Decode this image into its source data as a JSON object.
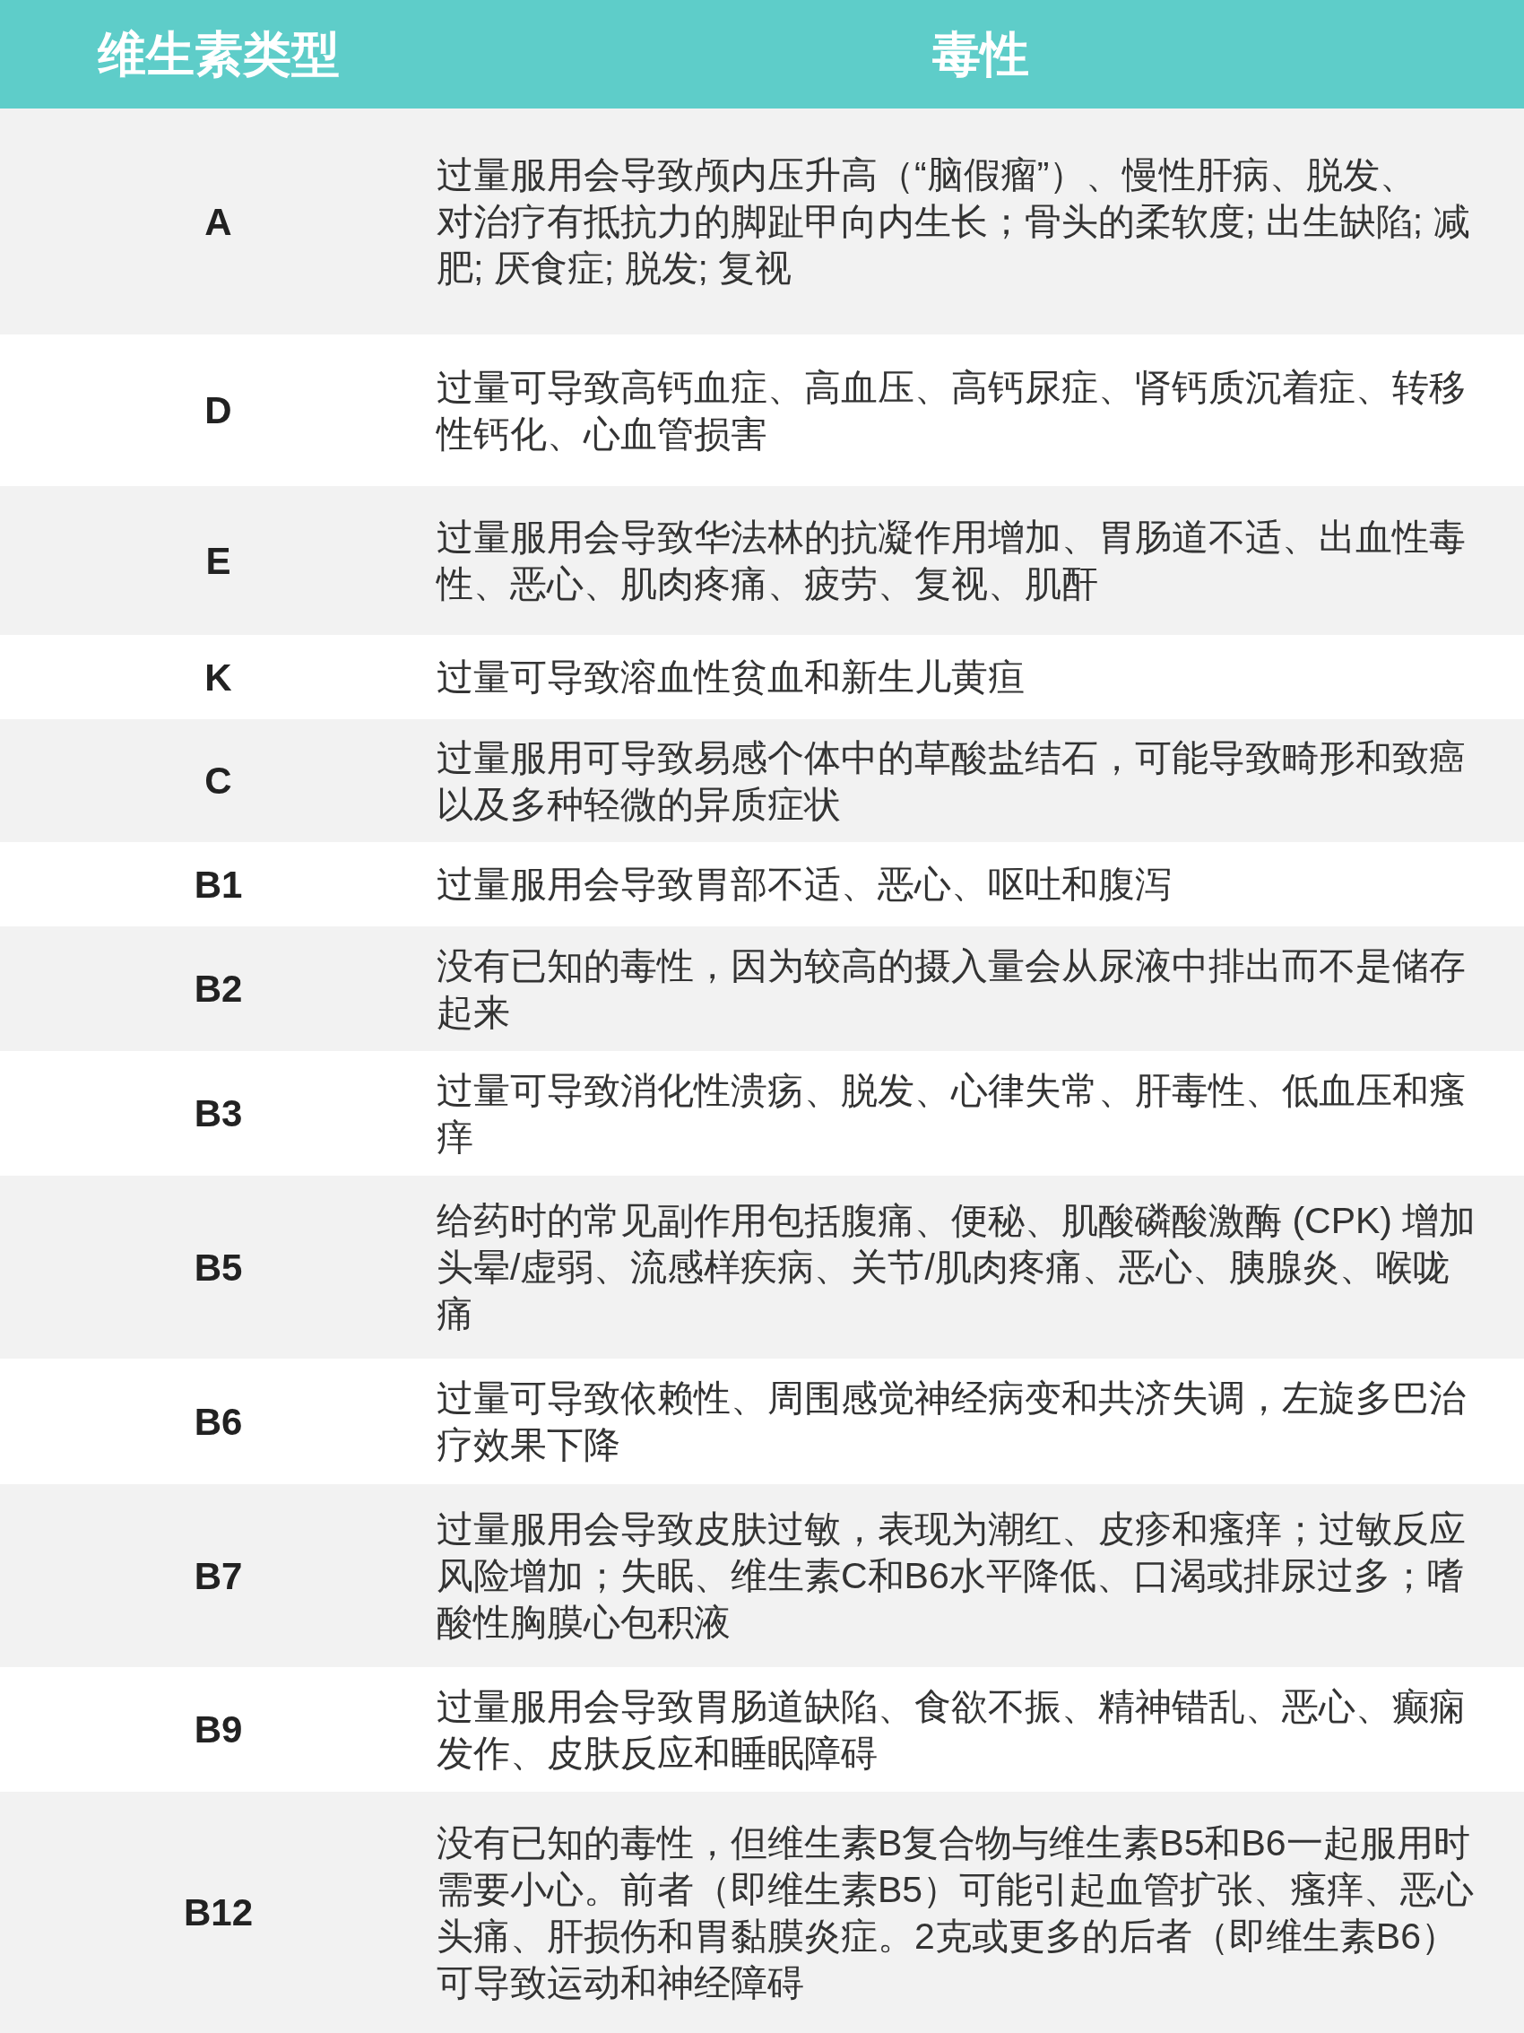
{
  "table": {
    "columns": [
      "维生素类型",
      "毒性"
    ],
    "rows": [
      {
        "vitamin": "A",
        "lines": [
          "过量服用会导致颅内压升高（“脑假瘤”）、慢性肝病、脱发、",
          "对治疗有抵抗力的脚趾甲向内生长；骨头的柔软度; 出生缺陷; 减",
          "肥; 厌食症; 脱发; 复视"
        ]
      },
      {
        "vitamin": "D",
        "lines": [
          "过量可导致高钙血症、高血压、高钙尿症、肾钙质沉着症、转移",
          "性钙化、心血管损害"
        ]
      },
      {
        "vitamin": "E",
        "lines": [
          "过量服用会导致华法林的抗凝作用增加、胃肠道不适、出血性毒",
          "性、恶心、肌肉疼痛、疲劳、复视、肌酐"
        ]
      },
      {
        "vitamin": "K",
        "lines": [
          "过量可导致溶血性贫血和新生儿黄疸"
        ]
      },
      {
        "vitamin": "C",
        "lines": [
          "过量服用可导致易感个体中的草酸盐结石，可能导致畸形和致癌",
          "以及多种轻微的异质症状"
        ]
      },
      {
        "vitamin": "B1",
        "lines": [
          "过量服用会导致胃部不适、恶心、呕吐和腹泻"
        ]
      },
      {
        "vitamin": "B2",
        "lines": [
          "没有已知的毒性，因为较高的摄入量会从尿液中排出而不是储存",
          "起来"
        ]
      },
      {
        "vitamin": "B3",
        "lines": [
          "过量可导致消化性溃疡、脱发、心律失常、肝毒性、低血压和瘙",
          "痒"
        ]
      },
      {
        "vitamin": "B5",
        "lines": [
          "给药时的常见副作用包括腹痛、便秘、肌酸磷酸激酶 (CPK) 增加",
          "头晕/虚弱、流感样疾病、关节/肌肉疼痛、恶心、胰腺炎、喉咙",
          "痛"
        ]
      },
      {
        "vitamin": "B6",
        "lines": [
          "过量可导致依赖性、周围感觉神经病变和共济失调，左旋多巴治",
          "疗效果下降"
        ]
      },
      {
        "vitamin": "B7",
        "lines": [
          "过量服用会导致皮肤过敏，表现为潮红、皮疹和瘙痒；过敏反应",
          "风险增加；失眠、维生素C和B6水平降低、口渴或排尿过多；嗜",
          "酸性胸膜心包积液"
        ]
      },
      {
        "vitamin": "B9",
        "lines": [
          "过量服用会导致胃肠道缺陷、食欲不振、精神错乱、恶心、癫痫",
          "发作、皮肤反应和睡眠障碍"
        ]
      },
      {
        "vitamin": "B12",
        "lines": [
          "没有已知的毒性，但维生素B复合物与维生素B5和B6一起服用时",
          "需要小心。前者（即维生素B5）可能引起血管扩张、瘙痒、恶心",
          "头痛、肝损伤和胃黏膜炎症。2克或更多的后者（即维生素B6）",
          "可导致运动和神经障碍"
        ]
      }
    ]
  }
}
